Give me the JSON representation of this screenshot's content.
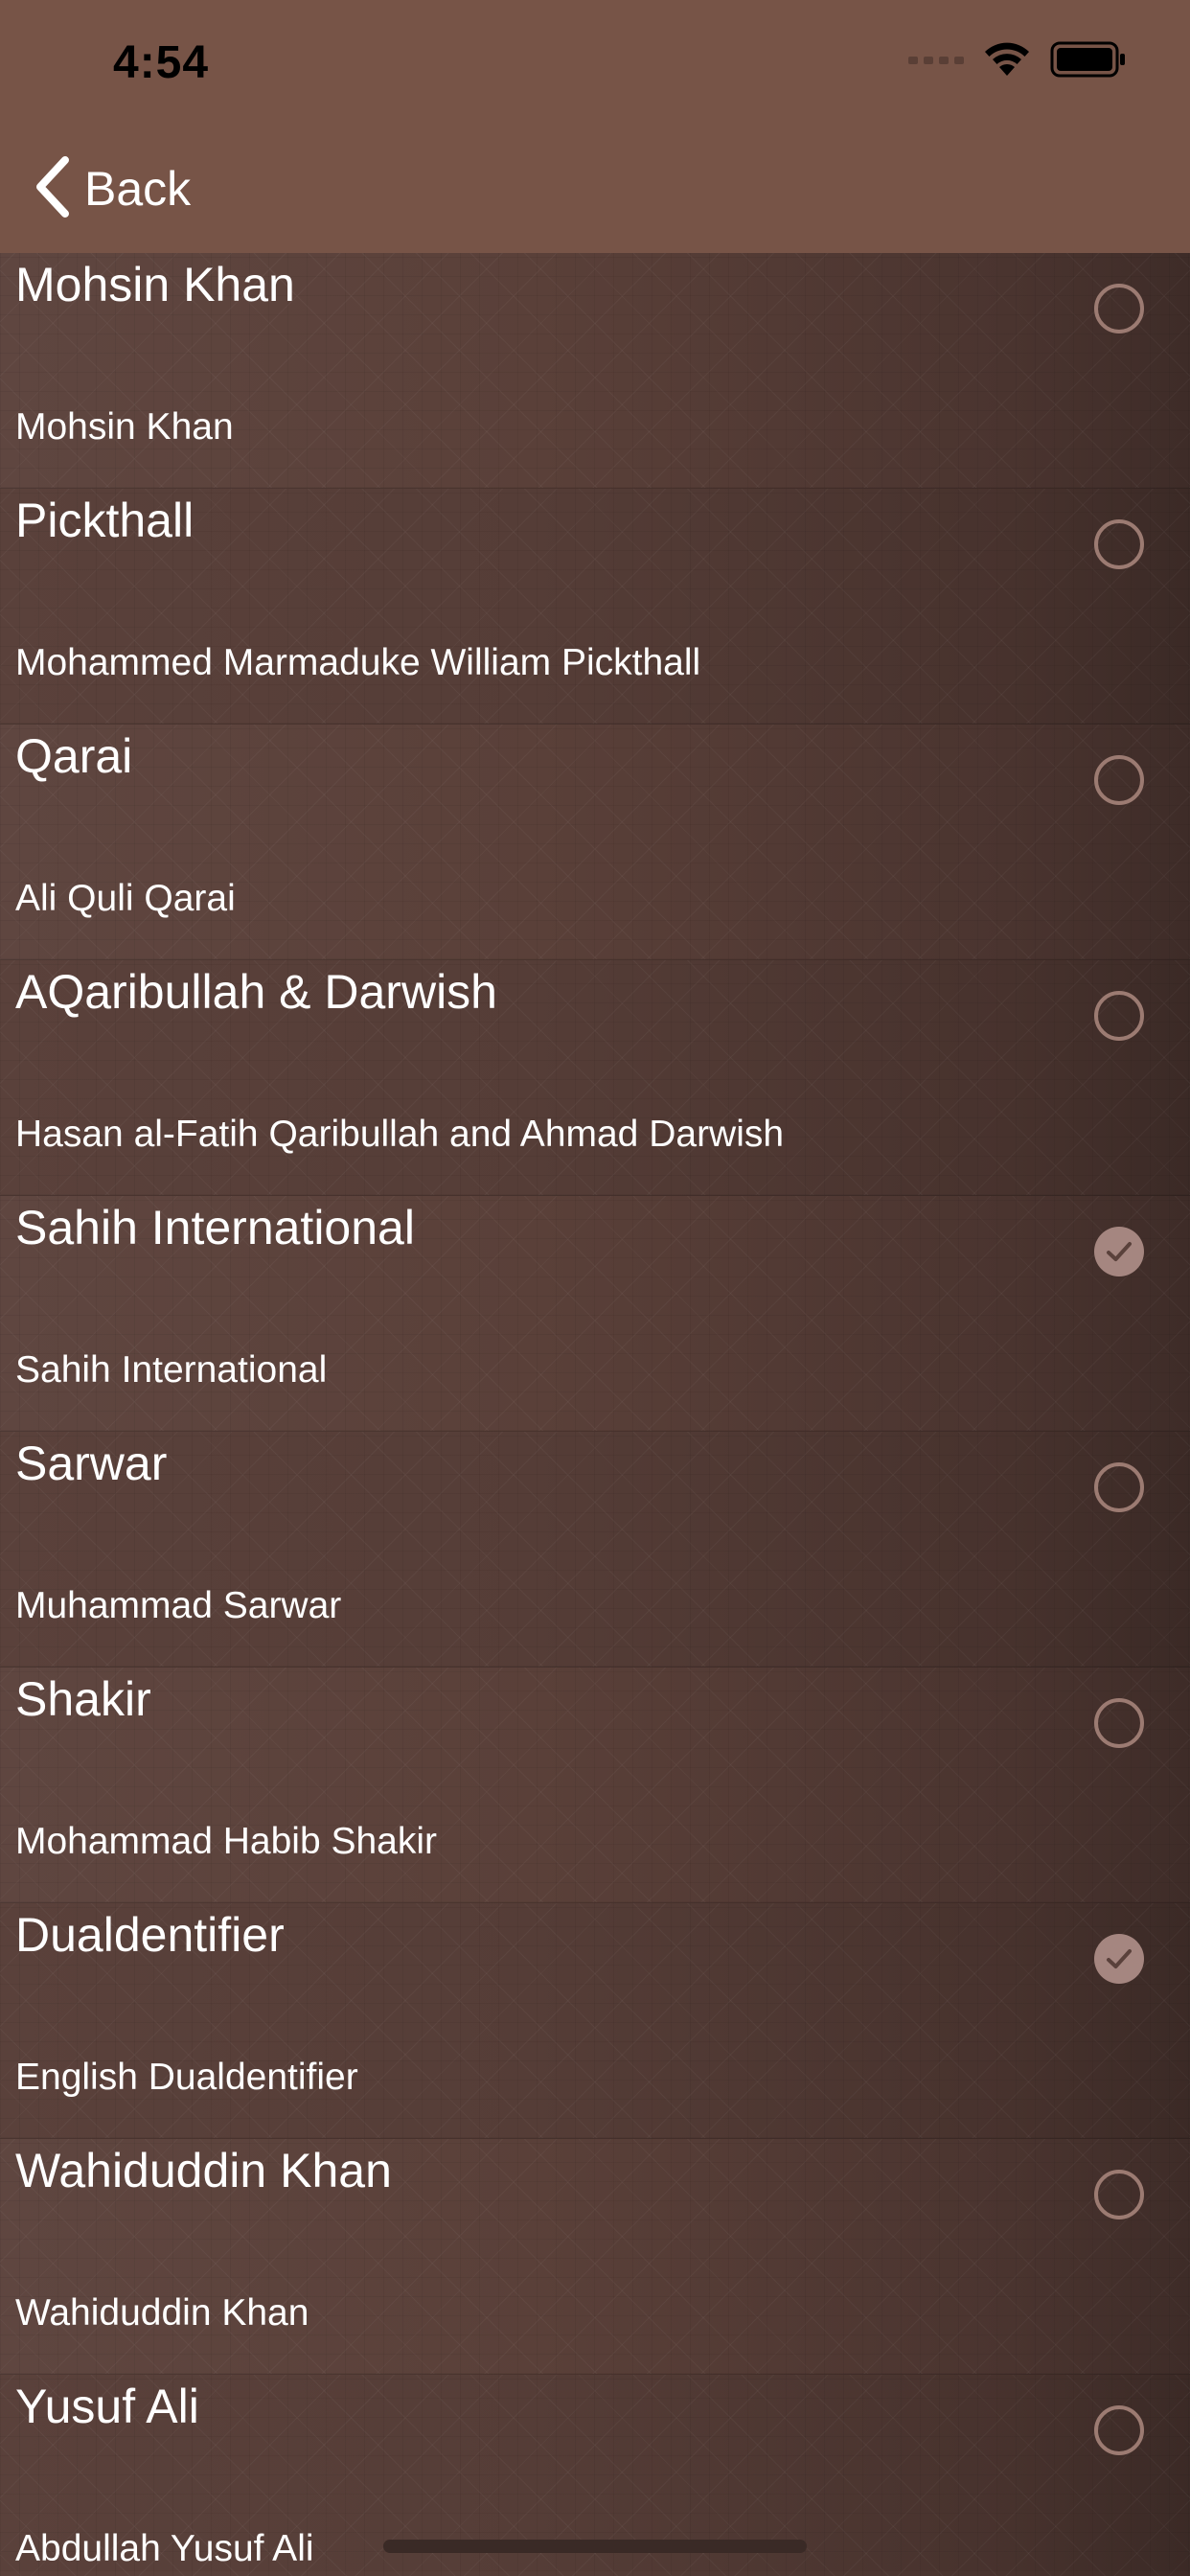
{
  "status_bar": {
    "time": "4:54",
    "icons": [
      "signal-icon",
      "wifi-icon",
      "battery-icon"
    ]
  },
  "nav": {
    "back_label": "Back",
    "back_icon": "chevron-left-icon"
  },
  "colors": {
    "nav_background": "#775447",
    "checked_indicator": "#a58680",
    "unchecked_ring": "#9c7b72"
  },
  "translations": [
    {
      "title": "Mohsin Khan",
      "subtitle": "Mohsin Khan",
      "selected": false
    },
    {
      "title": "Pickthall",
      "subtitle": "Mohammed Marmaduke William Pickthall",
      "selected": false
    },
    {
      "title": "Qarai",
      "subtitle": "Ali Quli Qarai",
      "selected": false
    },
    {
      "title": "AQaribullah & Darwish",
      "subtitle": "Hasan al-Fatih Qaribullah and Ahmad Darwish",
      "selected": false
    },
    {
      "title": "Sahih International",
      "subtitle": "Sahih International",
      "selected": true
    },
    {
      "title": "Sarwar",
      "subtitle": "Muhammad Sarwar",
      "selected": false
    },
    {
      "title": "Shakir",
      "subtitle": "Mohammad Habib Shakir",
      "selected": false
    },
    {
      "title": "Dualdentifier",
      "subtitle": "English Dualdentifier",
      "selected": true
    },
    {
      "title": "Wahiduddin Khan",
      "subtitle": "Wahiduddin Khan",
      "selected": false
    },
    {
      "title": "Yusuf Ali",
      "subtitle": "Abdullah Yusuf Ali",
      "selected": false
    }
  ]
}
